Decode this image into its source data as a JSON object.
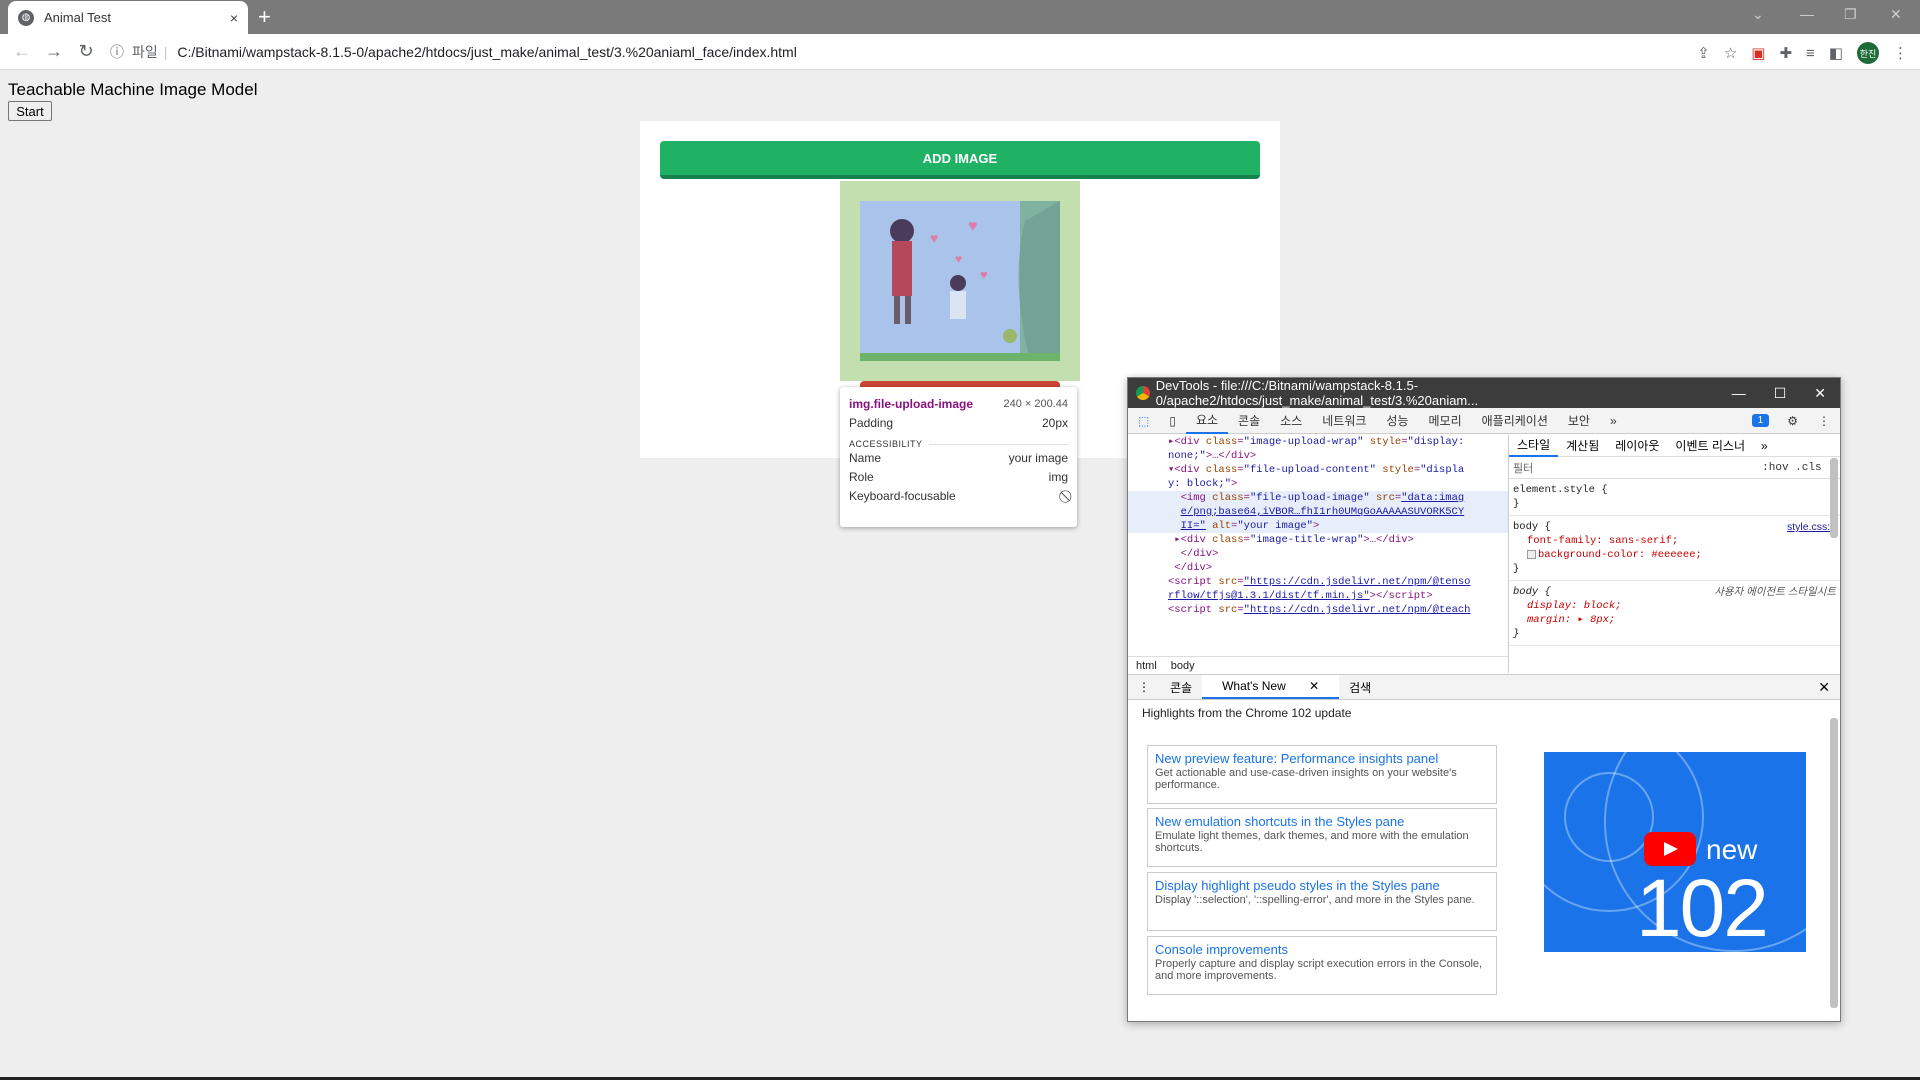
{
  "browser": {
    "tab_title": "Animal Test",
    "tab_close": "×",
    "new_tab": "+",
    "url_scheme_label": "파일",
    "url": "C:/Bitnami/wampstack-8.1.5-0/apache2/htdocs/just_make/animal_test/3.%20aniaml_face/index.html",
    "avatar_text": "한진"
  },
  "page": {
    "title": "Teachable Machine Image Model",
    "start_button": "Start",
    "add_image_button": "ADD IMAGE",
    "image_alt": "your image"
  },
  "tooltip": {
    "selector": "img.file-upload-image",
    "size": "240 × 200.44",
    "padding_label": "Padding",
    "padding_value": "20px",
    "section": "ACCESSIBILITY",
    "name_label": "Name",
    "name_value": "your image",
    "role_label": "Role",
    "role_value": "img",
    "focus_label": "Keyboard-focusable"
  },
  "devtools": {
    "title": "DevTools - file:///C:/Bitnami/wampstack-8.1.5-0/apache2/htdocs/just_make/animal_test/3.%20aniam...",
    "tabs": [
      "요소",
      "콘솔",
      "소스",
      "네트워크",
      "성능",
      "메모리",
      "애플리케이션",
      "보안",
      "»"
    ],
    "issues_badge": "1",
    "style_tabs": [
      "스타일",
      "계산됨",
      "레이아웃",
      "이벤트 리스너",
      "»"
    ],
    "filter_placeholder": "필터",
    "filter_hov": ":hov .cls",
    "breadcrumbs": [
      "html",
      "body"
    ],
    "styles": {
      "element_style": "element.style {",
      "close": "}",
      "body1_sel": "body {",
      "body1_src": "style.css:1",
      "body1_p1": "font-family: sans-serif;",
      "body1_p2": "background-color: #eeeeee;",
      "body2_sel": "body {",
      "body2_src": "사용자 에이전트 스타일시트",
      "body2_p1": "display: block;",
      "body2_p2": "margin: ▸ 8px;"
    },
    "drawer_tabs": [
      "콘솔",
      "What's New",
      "검색"
    ],
    "drawer_heading": "Highlights from the Chrome 102 update",
    "news": [
      {
        "title": "New preview feature: Performance insights panel",
        "desc": "Get actionable and use-case-driven insights on your website's performance."
      },
      {
        "title": "New emulation shortcuts in the Styles pane",
        "desc": "Emulate light themes, dark themes, and more with the emulation shortcuts."
      },
      {
        "title": "Display highlight pseudo styles in the Styles pane",
        "desc": "Display '::selection', '::spelling-error', and more in the Styles pane."
      },
      {
        "title": "Console improvements",
        "desc": "Properly capture and display script execution errors in the Console, and more improvements."
      }
    ],
    "promo_new": "new",
    "promo_version": "102"
  },
  "colors": {
    "add_button": "#1fb264",
    "upload_bg": "#c3dfb0",
    "remove_button": "#cd4535",
    "devtools_accent": "#1a73e8"
  }
}
